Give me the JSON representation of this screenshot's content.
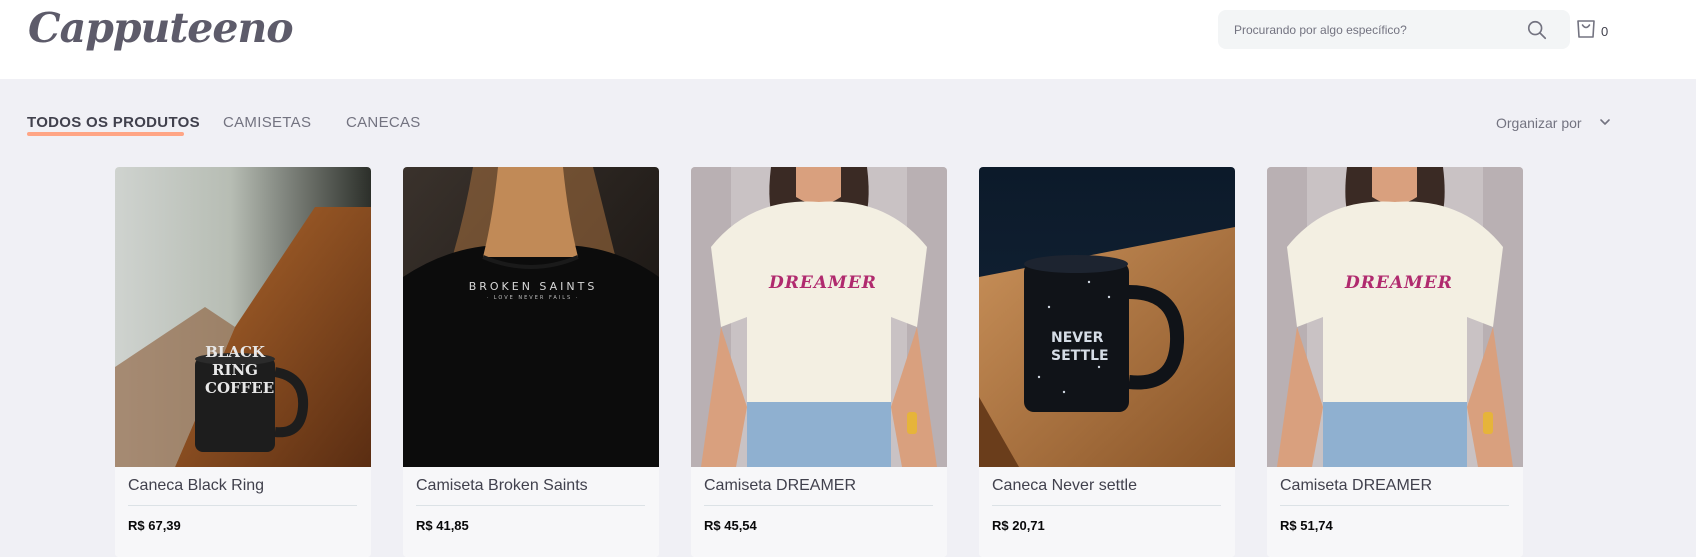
{
  "header": {
    "logo": "Capputeeno",
    "search": {
      "placeholder": "Procurando por algo específico?",
      "value": ""
    },
    "cart_count": "0"
  },
  "filters": {
    "tabs": [
      {
        "label": "TODOS OS PRODUTOS",
        "active": true
      },
      {
        "label": "CAMISETAS",
        "active": false
      },
      {
        "label": "CANECAS",
        "active": false
      }
    ],
    "sort_label": "Organizar por"
  },
  "products": [
    {
      "name": "Caneca Black Ring",
      "price": "R$ 67,39",
      "image": "black-ring-mug-photo",
      "mug_text": "BLACK RING COFFEE"
    },
    {
      "name": "Camiseta Broken Saints",
      "price": "R$ 41,85",
      "image": "broken-saints-tshirt-photo",
      "shirt_text": "BROKEN SAINTS",
      "shirt_sub": "· LOVE NEVER FAILS ·"
    },
    {
      "name": "Camiseta DREAMER",
      "price": "R$ 45,54",
      "image": "dreamer-tshirt-photo",
      "shirt_text": "DREAMER"
    },
    {
      "name": "Caneca Never settle",
      "price": "R$ 20,71",
      "image": "never-settle-mug-photo",
      "mug_text": "NEVER SETTLE"
    },
    {
      "name": "Camiseta DREAMER",
      "price": "R$ 51,74",
      "image": "dreamer-tshirt-photo",
      "shirt_text": "DREAMER"
    }
  ],
  "colors": {
    "accent": "#ffa585",
    "text": "#41414d",
    "muted": "#737380",
    "background": "#f0f0f5"
  }
}
